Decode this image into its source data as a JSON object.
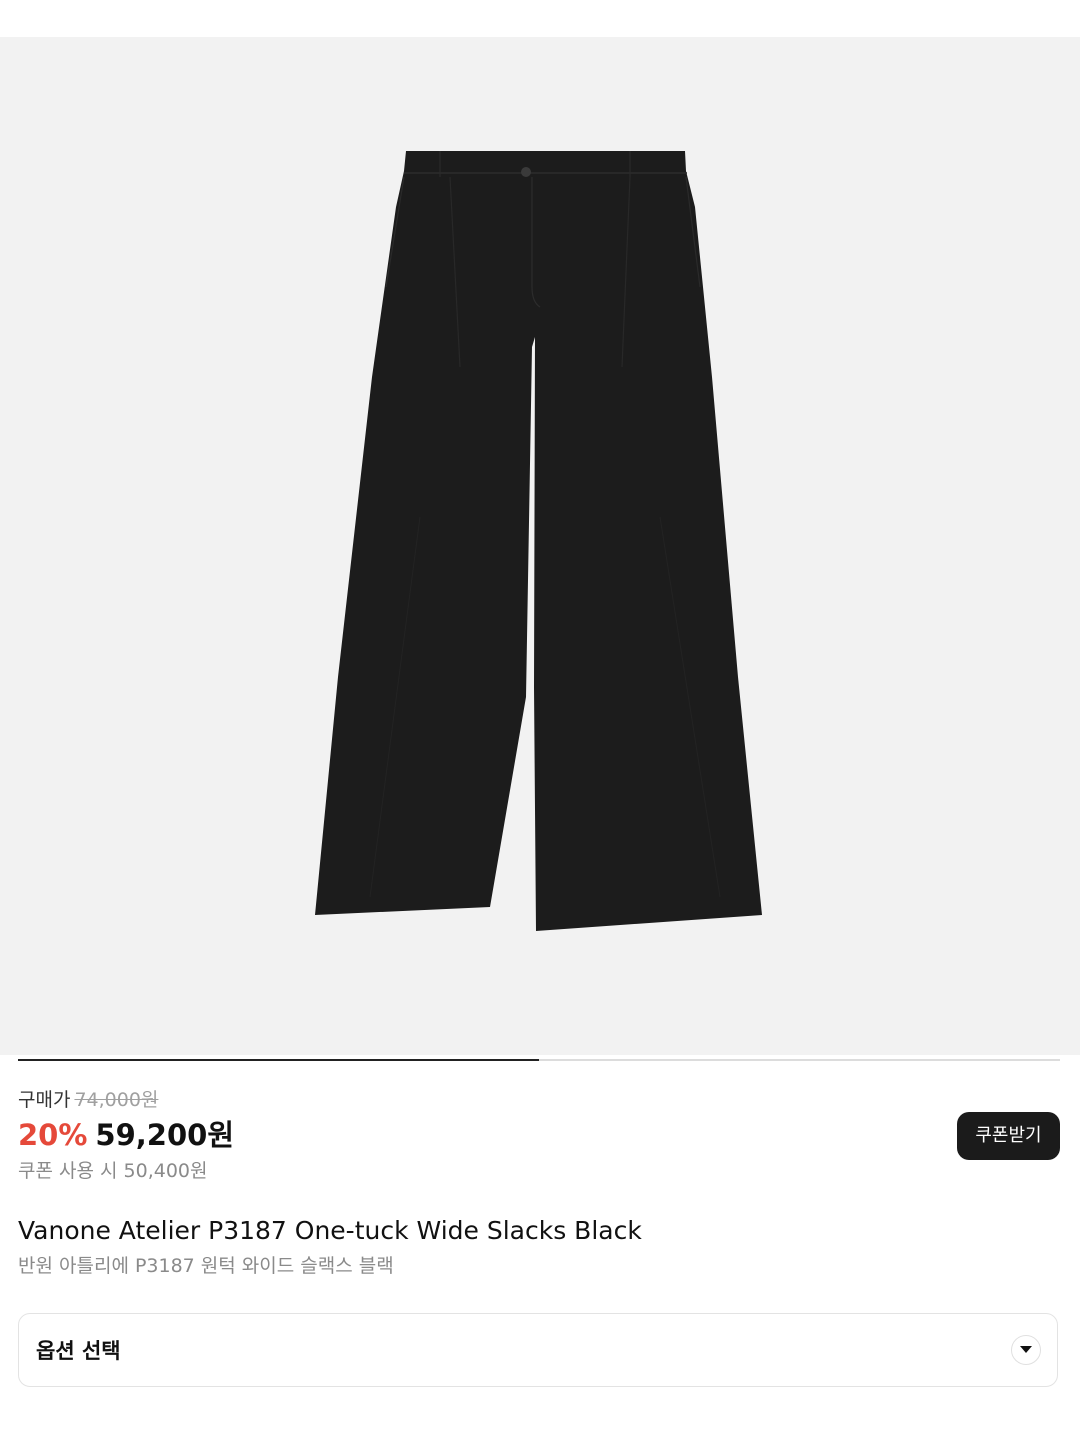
{
  "gallery": {
    "image_alt": "Black one-tuck wide slacks product photo",
    "slide_progress": 0.5
  },
  "price": {
    "label": "구매가",
    "original": "74,000원",
    "discount": "20%",
    "sale": "59,200원",
    "coupon_price": "쿠폰 사용 시 50,400원",
    "coupon_button": "쿠폰받기"
  },
  "product": {
    "name": "Vanone Atelier P3187 One-tuck Wide Slacks Black",
    "name_ko": "반원 아틀리에 P3187 원턱 와이드 슬랙스 블랙"
  },
  "option": {
    "label": "옵션 선택",
    "icon": "chevron-down-icon"
  },
  "colors": {
    "gallery_bg": "#f2f2f2",
    "discount": "#e5493a",
    "button_bg": "#1b1b1b"
  }
}
